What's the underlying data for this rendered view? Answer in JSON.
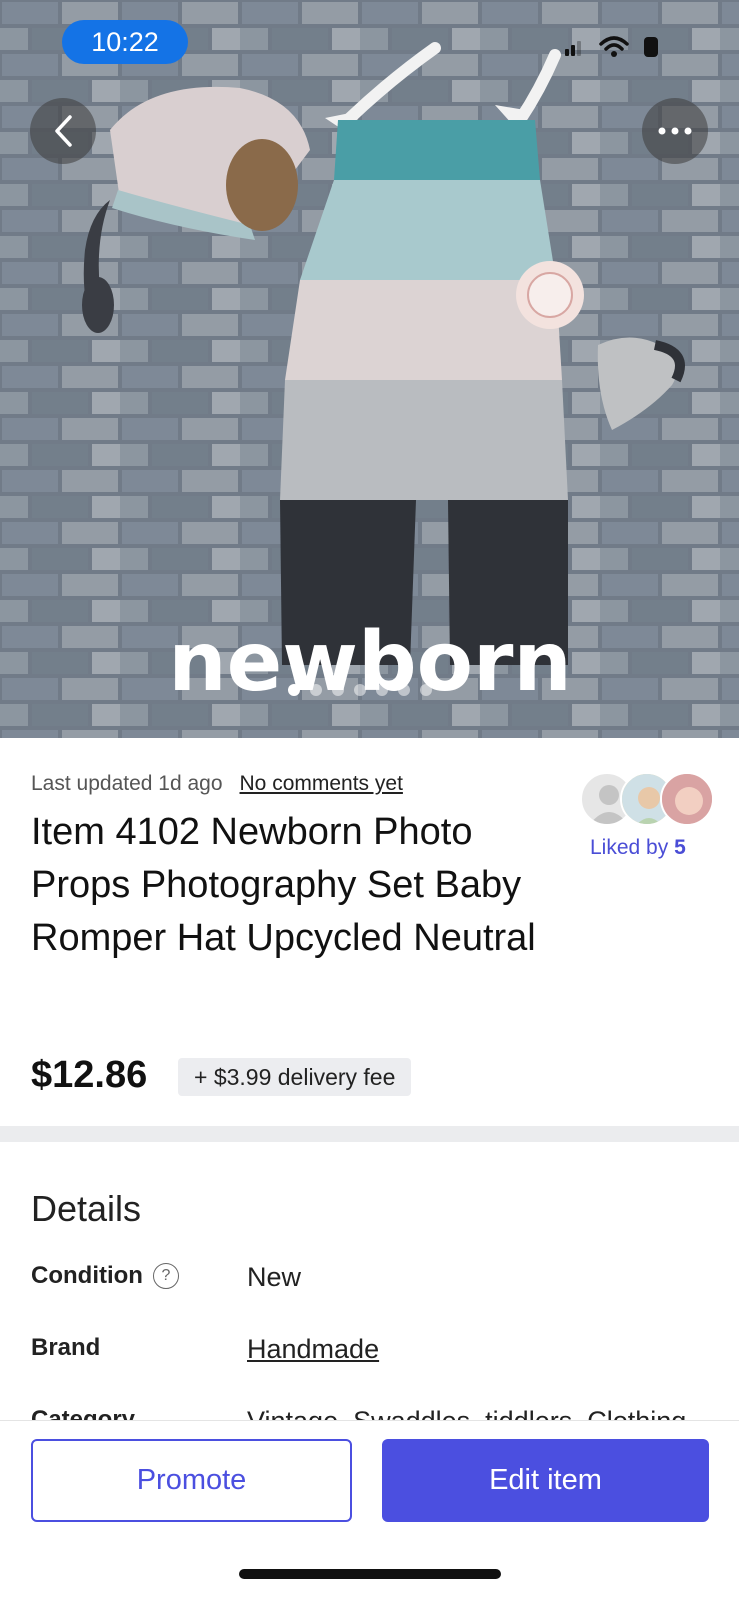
{
  "status_bar": {
    "time": "10:22"
  },
  "listing": {
    "last_updated": "Last updated 1d ago",
    "comments_link": "No comments yet",
    "liked_by_prefix": "Liked by",
    "liked_by_count": "5",
    "title": "Item 4102 Newborn Photo Props Photography Set Baby Romper Hat Upcycled Neutral",
    "price": "$12.86",
    "delivery_fee": "+ $3.99 delivery fee",
    "photo_caption": "newborn",
    "photo_count": 7,
    "photo_index": 1
  },
  "details": {
    "heading": "Details",
    "rows": [
      {
        "label": "Condition",
        "value": "New"
      },
      {
        "label": "Brand",
        "value": "Handmade"
      },
      {
        "label": "Category",
        "value": "Vintage, Swaddles, tiddlers, Clothing"
      }
    ]
  },
  "actions": {
    "promote": "Promote",
    "edit": "Edit item"
  },
  "colors": {
    "accent": "#4b4fe0",
    "time_pill": "#1473e6",
    "fee_bg": "#ecedf0"
  },
  "icons": [
    "back-chevron-icon",
    "more-dots-icon",
    "signal-icon",
    "wifi-icon",
    "battery-icon",
    "help-circle-icon"
  ]
}
